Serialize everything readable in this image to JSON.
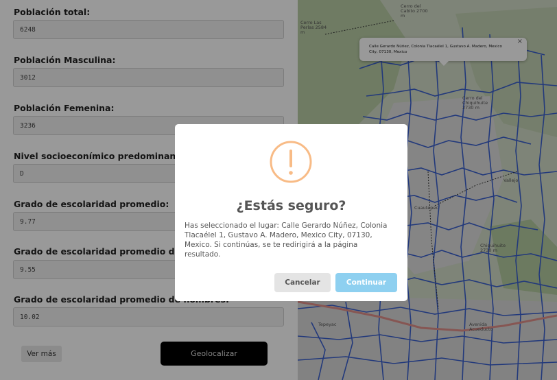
{
  "form": {
    "fields": [
      {
        "label": "Población total:",
        "value": "6248"
      },
      {
        "label": "Población Masculina:",
        "value": "3012"
      },
      {
        "label": "Población Femenina:",
        "value": "3236"
      },
      {
        "label": "Nivel socioeconímico predominante:",
        "value": "D"
      },
      {
        "label": "Grado de escolaridad promedio:",
        "value": "9.77"
      },
      {
        "label": "Grado de escolaridad promedio de mujeres:",
        "value": "9.55"
      },
      {
        "label": "Grado de escolaridad promedio de hombres:",
        "value": "10.02"
      }
    ],
    "more_label": "Ver más",
    "geolocate_label": "Geolocalizar"
  },
  "map": {
    "popup_text": "Calle Gerardo Núñez, Colonia Tlacaélel 1, Gustavo A. Madero, Mexico City, 07130, Mexico",
    "popup_close": "×",
    "labels": [
      "Cerro Las Perlas 2584 m",
      "Cerro del Cabito 2700 m",
      "Cerro del Chiquihuite 2730 m",
      "Vallejo",
      "Cuautepec",
      "Avenida Acueducto",
      "Chiquihuite 2730 m",
      "Tepeyac"
    ],
    "colors": {
      "boundary": "#3a5fcd",
      "road": "#e0908a"
    }
  },
  "modal": {
    "icon": "warning-icon",
    "title": "¿Estás seguro?",
    "text": "Has seleccionado el lugar: Calle Gerardo Núñez, Colonia Tlacaélel 1, Gustavo A. Madero, Mexico City, 07130, Mexico. Si continúas, se te redirigirá a la página resultado.",
    "cancel_label": "Cancelar",
    "continue_label": "Continuar",
    "accent": "#f8bb86"
  }
}
